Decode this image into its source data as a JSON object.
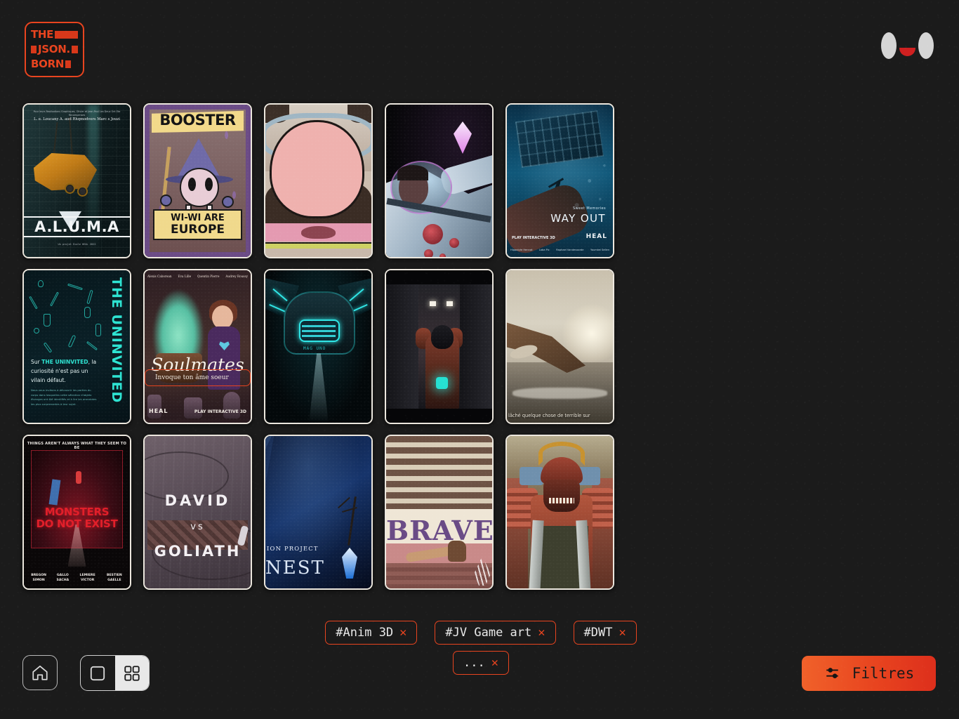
{
  "header": {
    "logo": {
      "line1": "THE",
      "line2": "JSON.",
      "line3": "BORN",
      "icon": "logo-mark"
    },
    "avatar": {
      "icon": "face-avatar-icon"
    }
  },
  "gallery": {
    "cards": [
      {
        "id": "aluma",
        "title": "A.L.U.M.A",
        "top_small": "Pour leurs Realisations Graphiques, Olivier et Jean-Paul Les Deux Ont Ete Recompenses",
        "top_line": "L. e. Loucany A. aud Rhqmodvers Marc s Jouzi",
        "credits": "Un projet Ecole HEAL 2022"
      },
      {
        "id": "booster",
        "title": "BOOSTER",
        "banner_line1": "WI-WI ARE",
        "banner_line2": "EUROPE"
      },
      {
        "id": "pink-character",
        "title": ""
      },
      {
        "id": "astronaut-crystal",
        "title": ""
      },
      {
        "id": "way-out",
        "subtitle": "Sweet Memories",
        "title": "WAY OUT",
        "studio_left": "PLAY INTERACTIVE 3D",
        "studio_right": "HEAL",
        "names": [
          "Hippolyte Hennot",
          "Loba Pic",
          "Raphael Vandevoorde",
          "Youmkei Sellen"
        ]
      },
      {
        "id": "the-uninvited",
        "title": "THE UNINVITED",
        "body_prefix": "Sur ",
        "body_brand": "THE UNINVITED",
        "body_rest": ", la curiosité n'est pas un vilain défaut.",
        "small": "Nous vous invitons à découvrir les parties du corps dans lesquelles cette sélection d'objets étranges ont été identifiés et à lire les anecdotes les plus surprenantes à leur sujet."
      },
      {
        "id": "soulmates",
        "title": "Soulmates",
        "tagline": "Invoque ton âme soeur",
        "names": [
          "Alexis\nCaborean",
          "Eva\nLille",
          "Quentin\nPierre",
          "Audrey\nRoussy"
        ],
        "studio_left": "HEAL",
        "studio_right": "PLAY INTERACTIVE 3D"
      },
      {
        "id": "neon-ship",
        "title": "",
        "glyph": "MAG UNO"
      },
      {
        "id": "corridor-mech",
        "title": ""
      },
      {
        "id": "sepia-landscape",
        "subtitle": "lâché quelque chose de terrible sur"
      },
      {
        "id": "monsters-do-not-exist",
        "tagline": "THINGS AREN'T ALWAYS WHAT THEY SEEM TO BE",
        "title_line1": "MONSTERS",
        "title_line2": "DO NOT EXIST",
        "names": [
          "BREGON\nSIMON",
          "GALLO\nSACHA",
          "LEMIERE\nVICTOR",
          "BESTIEN\nGAELLE"
        ]
      },
      {
        "id": "david-vs-goliath",
        "title_line1": "DAVID",
        "title_line2": "vs",
        "title_line3": "GOLIATH"
      },
      {
        "id": "nest",
        "supertitle": "ION PROJECT",
        "title": "NEST"
      },
      {
        "id": "brave",
        "title": "BRAVE"
      },
      {
        "id": "samurai",
        "title": ""
      }
    ]
  },
  "footer": {
    "home_button": {
      "label": "",
      "icon": "home-icon"
    },
    "view_toggle": {
      "list_view": {
        "icon": "single-square-icon",
        "active": false
      },
      "grid_view": {
        "icon": "grid-four-squares-icon",
        "active": true
      }
    },
    "tags": [
      {
        "label": "#Anim 3D",
        "remove": "✕"
      },
      {
        "label": "#JV Game art",
        "remove": "✕"
      },
      {
        "label": "#DWT",
        "remove": "✕"
      },
      {
        "label": "...",
        "remove": "✕"
      }
    ],
    "filters_button": {
      "label": "Filtres",
      "icon": "sliders-icon"
    }
  },
  "colors": {
    "accent": "#e8441f",
    "background": "#1b1b1b",
    "card_border": "#ece7de",
    "text": "#e9e9e9"
  }
}
